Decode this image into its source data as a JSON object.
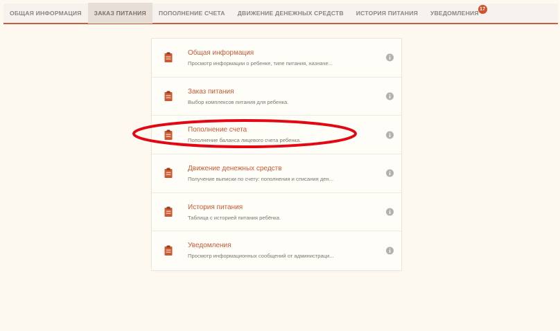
{
  "colors": {
    "accent": "#cb5a33",
    "tab_border": "#c65e3a",
    "badge": "#d2522b",
    "annotation": "#e30613",
    "background": "#fdf9f1"
  },
  "tabs": [
    {
      "label": "ОБЩАЯ ИНФОРМАЦИЯ",
      "active": false
    },
    {
      "label": "ЗАКАЗ ПИТАНИЯ",
      "active": true
    },
    {
      "label": "ПОПОЛНЕНИЕ СЧЕТА",
      "active": false
    },
    {
      "label": "ДВИЖЕНИЕ ДЕНЕЖНЫХ СРЕДСТВ",
      "active": false
    },
    {
      "label": "ИСТОРИЯ ПИТАНИЯ",
      "active": false
    },
    {
      "label": "УВЕДОМЛЕНИЯ",
      "active": false,
      "badge": "17"
    }
  ],
  "menu": {
    "items": [
      {
        "title": "Общая информация",
        "description": "Просмотр информации о ребенке, типе питания, назначе...",
        "icon": "clipboard-icon",
        "info_icon": "info-icon"
      },
      {
        "title": "Заказ питания",
        "description": "Выбор комплексов питания для ребенка.",
        "icon": "clipboard-icon",
        "info_icon": "info-icon"
      },
      {
        "title": "Пополнение счета",
        "description": "Пополнение баланса лицевого счета ребенка.",
        "icon": "clipboard-icon",
        "info_icon": "info-icon",
        "highlighted": true
      },
      {
        "title": "Движение денежных средств",
        "description": "Получение выписки по счету: пополнения и списания ден...",
        "icon": "clipboard-icon",
        "info_icon": "info-icon"
      },
      {
        "title": "История питания",
        "description": "Таблица с историей питания ребёнка.",
        "icon": "clipboard-icon",
        "info_icon": "info-icon"
      },
      {
        "title": "Уведомления",
        "description": "Просмотр информационных сообщений от администраци...",
        "icon": "clipboard-icon",
        "info_icon": "info-icon"
      }
    ]
  }
}
